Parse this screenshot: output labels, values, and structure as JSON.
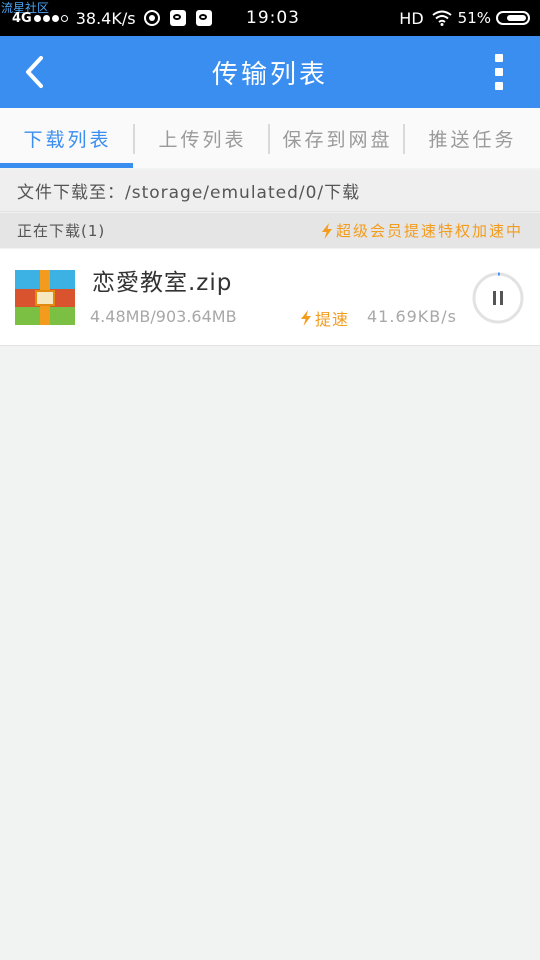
{
  "status_bar": {
    "watermark": "流星社区",
    "network": "4G",
    "speed": "38.4K/s",
    "time": "19:03",
    "hd": "HD",
    "battery": "51%"
  },
  "header": {
    "title": "传输列表",
    "back_icon": "chevron-left-icon",
    "more_icon": "more-vertical-icon"
  },
  "tabs": [
    {
      "label": "下载列表",
      "active": true
    },
    {
      "label": "上传列表",
      "active": false
    },
    {
      "label": "保存到网盘",
      "active": false
    },
    {
      "label": "推送任务",
      "active": false
    }
  ],
  "path": "文件下载至：/storage/emulated/0/下载",
  "section": {
    "title": "正在下载(1)",
    "vip": "超级会员提速特权加速中"
  },
  "downloads": [
    {
      "name": "恋愛教室.zip",
      "size": "4.48MB/903.64MB",
      "boost_label": "提速",
      "speed": "41.69KB/s",
      "progress": 0.005
    }
  ],
  "colors": {
    "accent": "#3a8ef0",
    "vip": "#f39c1e"
  }
}
